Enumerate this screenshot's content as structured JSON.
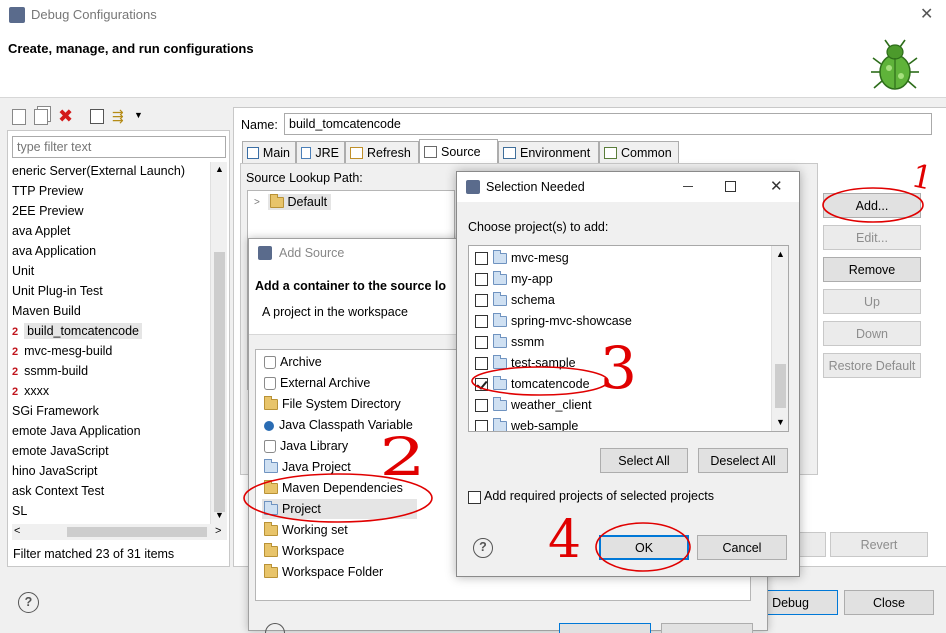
{
  "window": {
    "title": "Debug Configurations",
    "header_title": "Create, manage, and run configurations"
  },
  "left_panel": {
    "filter_placeholder": "type filter text",
    "items": [
      {
        "label": "eneric Server(External Launch)",
        "badge": ""
      },
      {
        "label": "TTP Preview",
        "badge": ""
      },
      {
        "label": "2EE Preview",
        "badge": ""
      },
      {
        "label": "ava Applet",
        "badge": ""
      },
      {
        "label": "ava Application",
        "badge": ""
      },
      {
        "label": "Unit",
        "badge": ""
      },
      {
        "label": "Unit Plug-in Test",
        "badge": ""
      },
      {
        "label": "Maven Build",
        "badge": ""
      },
      {
        "label": "build_tomcatencode",
        "badge": "2"
      },
      {
        "label": "mvc-mesg-build",
        "badge": "2"
      },
      {
        "label": "ssmm-build",
        "badge": "2"
      },
      {
        "label": "xxxx",
        "badge": "2"
      },
      {
        "label": "SGi Framework",
        "badge": ""
      },
      {
        "label": "emote Java Application",
        "badge": ""
      },
      {
        "label": "emote JavaScript",
        "badge": ""
      },
      {
        "label": "hino JavaScript",
        "badge": ""
      },
      {
        "label": "ask Context Test",
        "badge": ""
      },
      {
        "label": "SL",
        "badge": ""
      }
    ],
    "filter_status": "Filter matched 23 of 31 items"
  },
  "config": {
    "name_label": "Name:",
    "name_value": "build_tomcatencode",
    "tabs": [
      "Main",
      "JRE",
      "Refresh",
      "Source",
      "Environment",
      "Common"
    ],
    "source_lookup_label": "Source Lookup Path:",
    "tree_default": "Default",
    "buttons": {
      "add": "Add...",
      "edit": "Edit...",
      "remove": "Remove",
      "up": "Up",
      "down": "Down",
      "restore_default": "Restore Default",
      "revert": "Revert"
    }
  },
  "footer": {
    "debug": "Debug",
    "close": "Close"
  },
  "add_source": {
    "title": "Add Source",
    "heading": "Add a container to the source lo",
    "subheading": "A project in the workspace",
    "items": [
      "Archive",
      "External Archive",
      "File System Directory",
      "Java Classpath Variable",
      "Java Library",
      "Java Project",
      "Maven Dependencies",
      "Project",
      "Working set",
      "Workspace",
      "Workspace Folder"
    ]
  },
  "selection_dialog": {
    "title": "Selection Needed",
    "prompt": "Choose project(s) to add:",
    "projects": [
      {
        "name": "mvc-mesg",
        "checked": false
      },
      {
        "name": "my-app",
        "checked": false
      },
      {
        "name": "schema",
        "checked": false
      },
      {
        "name": "spring-mvc-showcase",
        "checked": false
      },
      {
        "name": "ssmm",
        "checked": false
      },
      {
        "name": "test-sample",
        "checked": false
      },
      {
        "name": "tomcatencode",
        "checked": true
      },
      {
        "name": "weather_client",
        "checked": false
      },
      {
        "name": "web-sample",
        "checked": false
      }
    ],
    "select_all": "Select All",
    "deselect_all": "Deselect All",
    "add_required_label": "Add required projects of selected projects",
    "ok": "OK",
    "cancel": "Cancel"
  },
  "annotations": [
    "1",
    "2",
    "3",
    "4"
  ],
  "colors": {
    "annotation": "#e00000",
    "selection": "#cce8ff",
    "badge": "#c0141c"
  }
}
